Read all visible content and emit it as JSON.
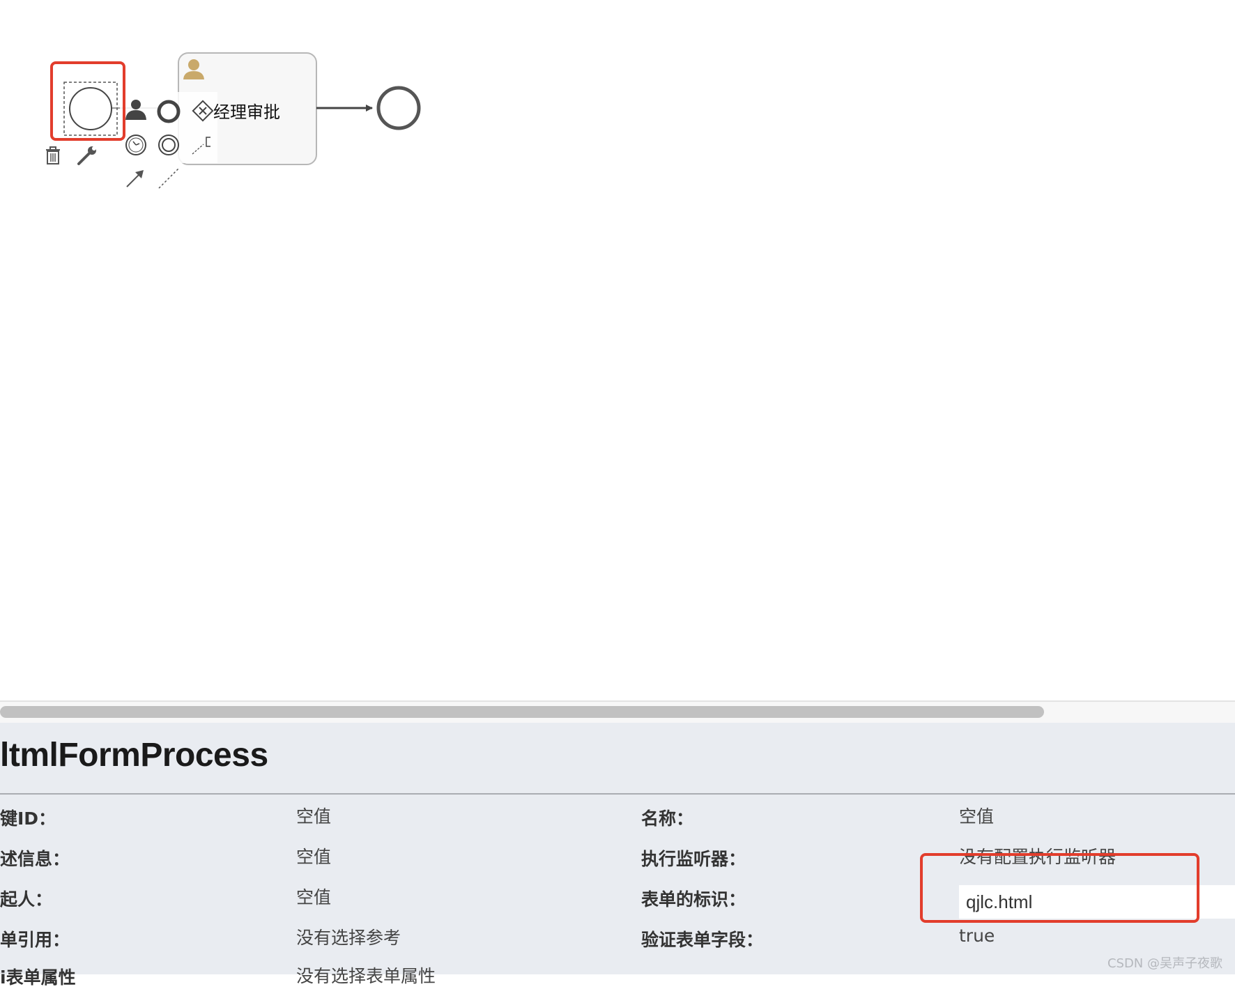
{
  "diagram": {
    "task_name": "经理审批"
  },
  "properties": {
    "title": "ltmlFormProcess",
    "left_rows": [
      {
        "label": "键ID：",
        "value": "空值"
      },
      {
        "label": "述信息：",
        "value": "空值"
      },
      {
        "label": "起人：",
        "value": "空值"
      },
      {
        "label": "单引用：",
        "value": "没有选择参考"
      },
      {
        "label": "i表单属性",
        "value": "没有选择表单属性"
      }
    ],
    "right_rows": [
      {
        "label": "名称：",
        "value": "空值"
      },
      {
        "label": "执行监听器：",
        "value": "没有配置执行监听器"
      },
      {
        "label": "表单的标识：",
        "value": "qjlc.html"
      },
      {
        "label": "验证表单字段：",
        "value": "true"
      }
    ]
  },
  "watermark": "CSDN @吴声子夜歌",
  "colors": {
    "highlight": "#e23d2c",
    "panel_bg": "#e9ecf1",
    "user_icon": "#c9a96a"
  }
}
